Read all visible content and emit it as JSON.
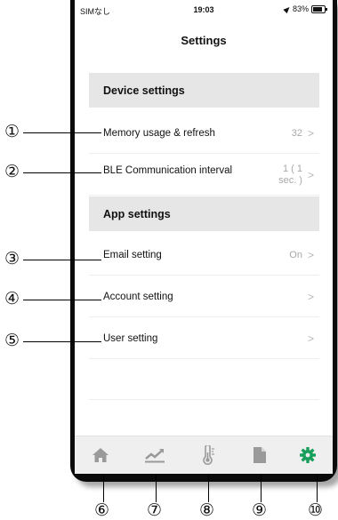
{
  "status_bar": {
    "carrier": "SIMなし",
    "time": "19:03",
    "battery": "83%"
  },
  "page_title": "Settings",
  "sections": {
    "device": "Device settings",
    "app": "App settings"
  },
  "rows": {
    "memory": {
      "label": "Memory usage & refresh",
      "value": "32"
    },
    "ble": {
      "label": "BLE Communication interval",
      "value_line1": "1 ( 1",
      "value_line2": "sec. )"
    },
    "email": {
      "label": "Email setting",
      "value": "On"
    },
    "account": {
      "label": "Account setting"
    },
    "user": {
      "label": "User setting"
    }
  },
  "chevron": ">",
  "tabbar": {
    "tabs": [
      "home-icon",
      "trend-chart-icon",
      "thermometer-icon",
      "document-icon",
      "gear-icon"
    ],
    "active_index": 4,
    "active_color": "#1a9e5c",
    "inactive_color": "#9a9a9a"
  },
  "callouts": [
    "①",
    "②",
    "③",
    "④",
    "⑤",
    "⑥",
    "⑦",
    "⑧",
    "⑨",
    "⑩"
  ]
}
